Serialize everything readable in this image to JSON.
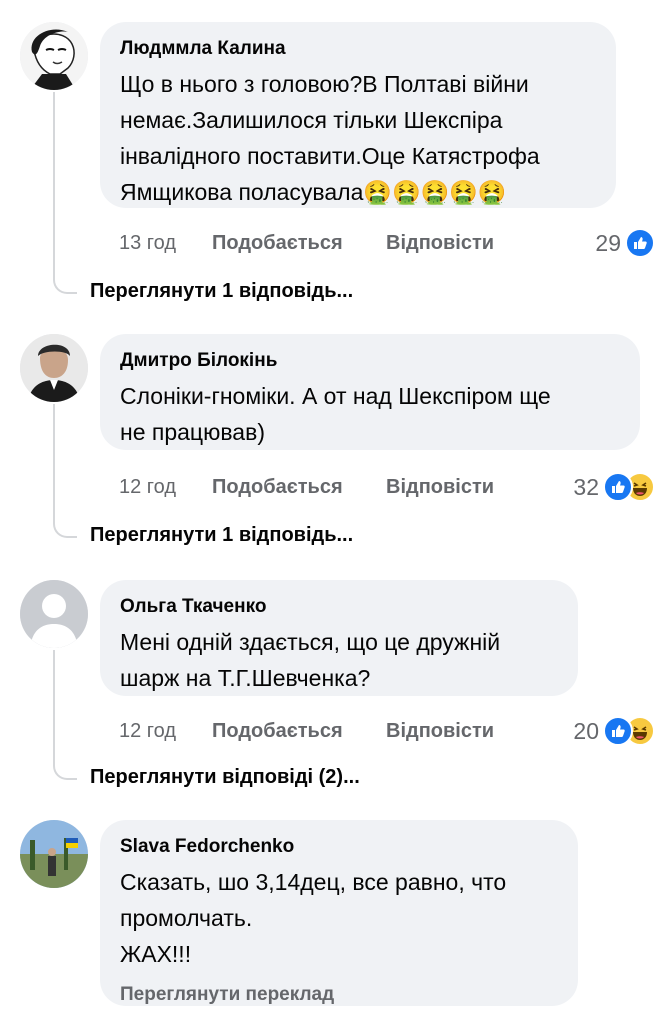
{
  "comments": [
    {
      "author": "Людммла Калина",
      "text": "Що в нього з головою?В Полтаві війни\nнемає.Залишилося тільки Шекспіра\nінвалідного поставити.Оце Катястрофа\nЯмщикова поласувала🤮🤮🤮🤮🤮",
      "time": "13 год",
      "like_label": "Подобається",
      "reply_label": "Відповісти",
      "reaction_count": "29",
      "reactions": [
        "like-icon"
      ],
      "view_replies": "Переглянути 1 відповідь..."
    },
    {
      "author": "Дмитро Білокінь",
      "text": "Слоніки-гноміки. А от над Шекспіром ще\nне працював)",
      "time": "12 год",
      "like_label": "Подобається",
      "reply_label": "Відповісти",
      "reaction_count": "32",
      "reactions": [
        "like-icon",
        "haha-icon"
      ],
      "view_replies": "Переглянути 1 відповідь..."
    },
    {
      "author": "Ольга Ткаченко",
      "text": "Мені одній здається, що це дружній\nшарж на Т.Г.Шевченка?",
      "time": "12 год",
      "like_label": "Подобається",
      "reply_label": "Відповісти",
      "reaction_count": "20",
      "reactions": [
        "like-icon",
        "haha-icon"
      ],
      "view_replies": "Переглянути відповіді (2)..."
    },
    {
      "author": "Slava Fedorchenko",
      "text": "Сказать, шо 3,14дец, все равно, что\nпромолчать.\nЖАХ!!!",
      "see_translation": "Переглянути переклад"
    }
  ],
  "colors": {
    "bubble_bg": "#f0f2f5",
    "secondary_text": "#65676b",
    "like_blue": "#1877f2",
    "haha_yellow": "#f7c940"
  }
}
